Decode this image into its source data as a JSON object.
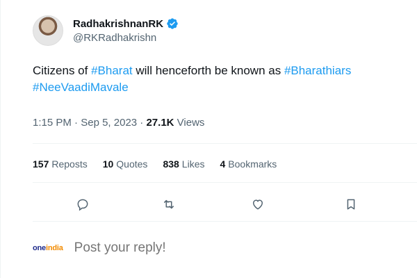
{
  "author": {
    "display_name": "RadhakrishnanRK",
    "handle": "@RKRadhakrishn",
    "verified": true,
    "accent_color": "#1d9bf0"
  },
  "tweet": {
    "parts": [
      {
        "text": "Citizens of "
      },
      {
        "text": "#Bharat",
        "hashtag": true
      },
      {
        "text": " will henceforth be known as "
      },
      {
        "text": "#Bharathiars",
        "hashtag": true
      },
      {
        "text": " "
      },
      {
        "text": "#NeeVaadiMavale",
        "hashtag": true
      }
    ],
    "time": "1:15 PM",
    "separator": "·",
    "date": "Sep 5, 2023",
    "views_count": "27.1K",
    "views_label": "Views"
  },
  "stats": [
    {
      "count": "157",
      "label": "Reposts"
    },
    {
      "count": "10",
      "label": "Quotes"
    },
    {
      "count": "838",
      "label": "Likes"
    },
    {
      "count": "4",
      "label": "Bookmarks"
    }
  ],
  "actions": [
    {
      "icon": "reply-icon"
    },
    {
      "icon": "repost-icon"
    },
    {
      "icon": "like-icon"
    },
    {
      "icon": "bookmark-icon"
    }
  ],
  "reply": {
    "brand_logo": {
      "left": "one",
      "right": "india"
    },
    "placeholder": "Post your reply!"
  }
}
